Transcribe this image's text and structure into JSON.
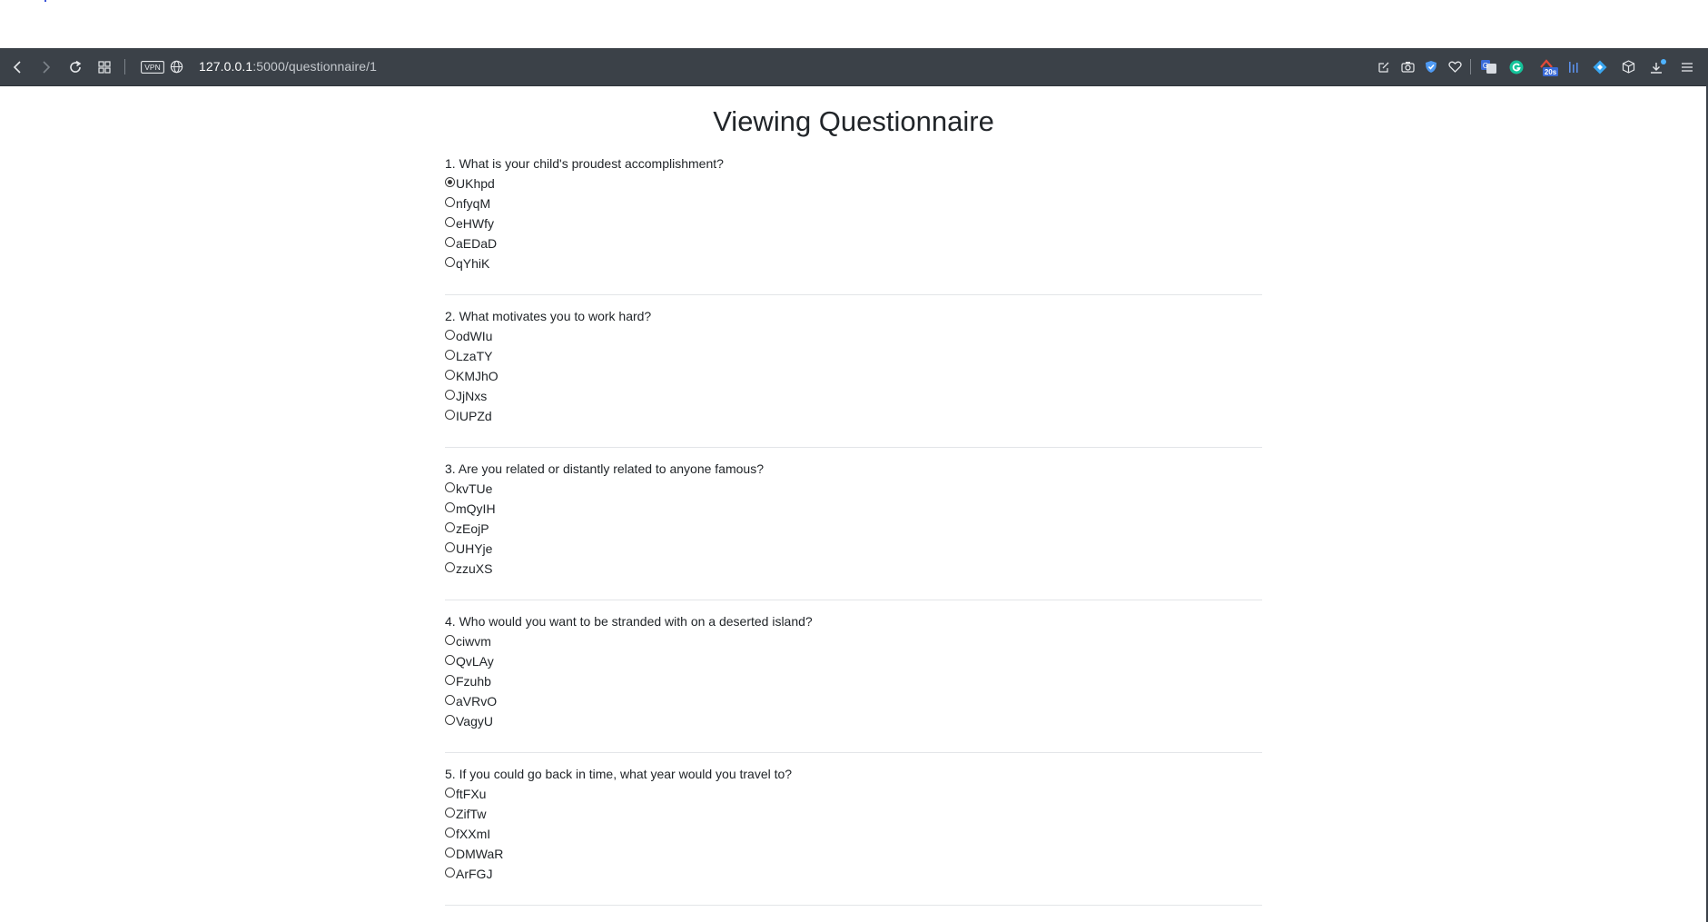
{
  "browser": {
    "url_host": "127.0.0.1",
    "url_rest": ":5000/questionnaire/1",
    "vpn_label": "VPN",
    "extension_badge": "20s",
    "icons": {
      "back": "back-arrow-icon",
      "forward": "forward-arrow-icon",
      "reload": "reload-icon",
      "tabs": "tab-grid-icon",
      "site": "globe-icon",
      "right": [
        "edit-share-icon",
        "camera-icon",
        "shield-icon",
        "heart-icon",
        "translate-icon",
        "grammarly-icon",
        "extension-icon",
        "bars-icon",
        "diamond-icon",
        "box-icon",
        "download-icon",
        "menu-icon"
      ]
    }
  },
  "page": {
    "title": "Viewing Questionnaire",
    "questions": [
      {
        "text": "1. What is your child's proudest accomplishment?",
        "options": [
          "UKhpd",
          "nfyqM",
          "eHWfy",
          "aEDaD",
          "qYhiK"
        ],
        "selected": 0
      },
      {
        "text": "2. What motivates you to work hard?",
        "options": [
          "odWIu",
          "LzaTY",
          "KMJhO",
          "JjNxs",
          "IUPZd"
        ],
        "selected": null
      },
      {
        "text": "3. Are you related or distantly related to anyone famous?",
        "options": [
          "kvTUe",
          "mQyIH",
          "zEojP",
          "UHYje",
          "zzuXS"
        ],
        "selected": null
      },
      {
        "text": "4. Who would you want to be stranded with on a deserted island?",
        "options": [
          "ciwvm",
          "QvLAy",
          "Fzuhb",
          "aVRvO",
          "VagyU"
        ],
        "selected": null
      },
      {
        "text": "5. If you could go back in time, what year would you travel to?",
        "options": [
          "ftFXu",
          "ZifTw",
          "fXXmI",
          "DMWaR",
          "ArFGJ"
        ],
        "selected": null
      }
    ]
  },
  "colors": {
    "toolbar_bg": "#3b4148",
    "text": "#212529"
  }
}
